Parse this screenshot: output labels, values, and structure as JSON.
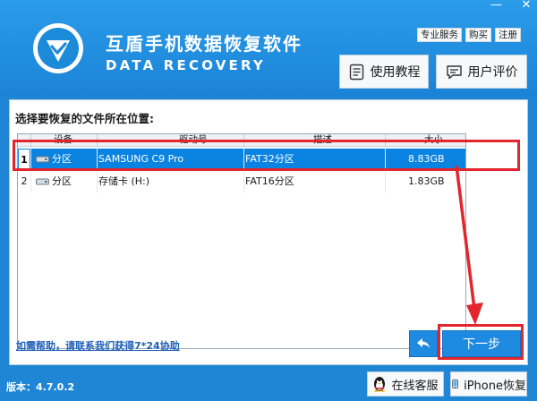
{
  "header": {
    "app_title": "互盾手机数据恢复软件",
    "app_subtitle": "DATA RECOVERY",
    "window_controls": {
      "minimize": "—",
      "close": "✕"
    },
    "top_links": [
      "专业服务",
      "购买",
      "注册"
    ],
    "tutorial_button": "使用教程",
    "review_button": "用户评价"
  },
  "panel": {
    "title": "选择要恢复的文件所在位置:",
    "columns": [
      "设备",
      "驱动号",
      "描述",
      "大小"
    ],
    "rows": [
      {
        "num": "1",
        "device": "分区",
        "drive": "SAMSUNG C9 Pro",
        "desc": "FAT32分区",
        "size": "8.83GB",
        "selected": true
      },
      {
        "num": "2",
        "device": "分区",
        "drive": "存储卡 (H:)",
        "desc": "FAT16分区",
        "size": "1.83GB",
        "selected": false
      }
    ],
    "help_link": "如需帮助，请联系我们获得7*24协助",
    "next_button": "下一步"
  },
  "footer": {
    "version": "版本：4.7.0.2",
    "support_button": "在线客服",
    "iphone_button": "iPhone恢复"
  },
  "colors": {
    "brand_blue": "#1f86d6",
    "selection_blue": "#0a84e0",
    "annotation_red": "#e3262d"
  },
  "icons": {
    "logo": "shield-check-icon",
    "tutorial": "document-icon",
    "review": "chat-icon",
    "back": "back-arrow-icon",
    "support": "qq-penguin-icon",
    "iphone": "iphone-icon",
    "disk": "disk-icon"
  }
}
